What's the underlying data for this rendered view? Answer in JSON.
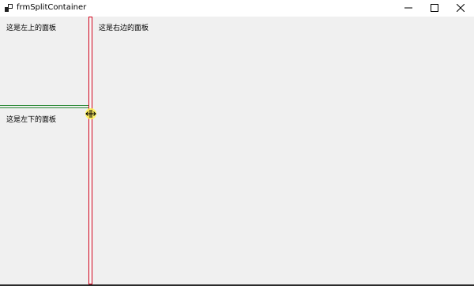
{
  "window": {
    "title": "frmSplitContainer",
    "app_icon": "winforms-app-icon",
    "controls": {
      "minimize_icon": "minimize-icon",
      "maximize_icon": "maximize-icon",
      "close_icon": "close-icon"
    }
  },
  "panels": {
    "left_top": {
      "label": "这是左上的面板"
    },
    "left_bottom": {
      "label": "这是左下的面板"
    },
    "right": {
      "label": "这是右边的面板"
    }
  },
  "splitters": {
    "horizontal_color": "#2e8b3a",
    "vertical_color": "#d0021b"
  },
  "cursor": {
    "icon": "resize-horizontal-cursor-icon",
    "highlight_color": "#fff550"
  }
}
